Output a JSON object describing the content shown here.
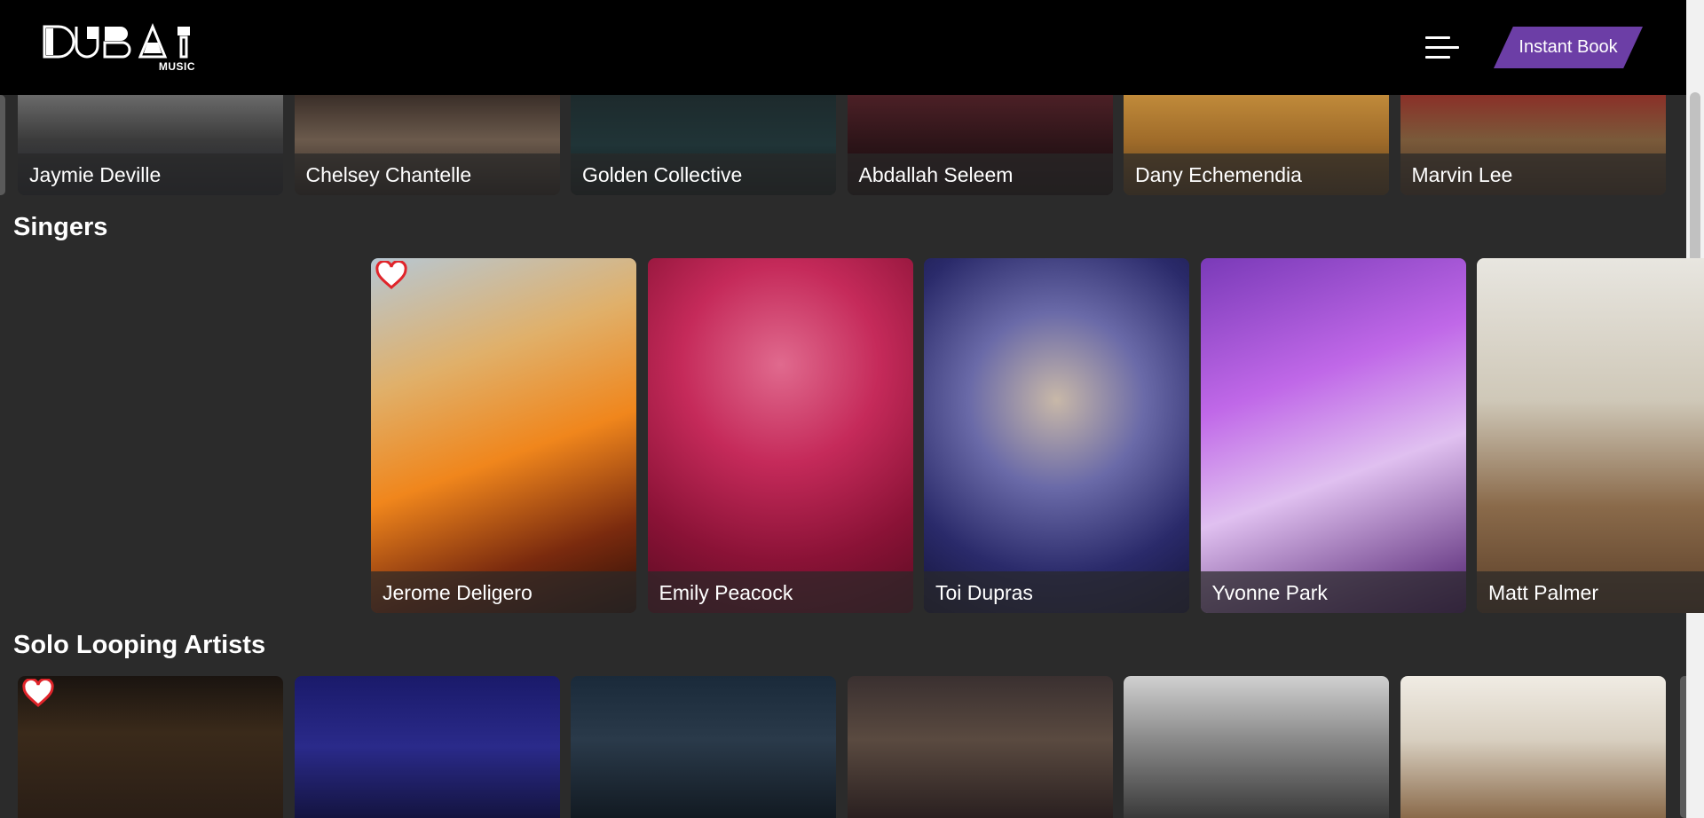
{
  "brand": {
    "name": "DUBAI",
    "sub": "MUSIC"
  },
  "header": {
    "instant_book_label": "Instant Book"
  },
  "top_row": {
    "artists": [
      {
        "name": "Jaymie Deville",
        "bg": "linear-gradient(180deg,#6a6a6a 0%,#3b3b3b 45%,#1d1f28 100%)"
      },
      {
        "name": "Chelsey Chantelle",
        "bg": "linear-gradient(180deg,#3a2e28 0%,#6b5a4c 45%,#2a221e 100%)"
      },
      {
        "name": "Golden Collective",
        "bg": "linear-gradient(180deg,#1d2a2c 0%,#203437 50%,#10181a 100%)"
      },
      {
        "name": "Abdallah Seleem",
        "bg": "linear-gradient(180deg,#4c2026 0%,#2c1418 50%,#140a0c 100%)"
      },
      {
        "name": "Dany Echemendia",
        "bg": "linear-gradient(180deg,#c08a3a 0%,#a06c2a 45%,#5a3e1e 100%)"
      },
      {
        "name": "Marvin Lee",
        "bg": "linear-gradient(180deg,#8a3028 0%,#7a5a3a 45%,#4a3424 100%)"
      }
    ]
  },
  "singers": {
    "title": "Singers",
    "artists": [
      {
        "name": "Jerome Deligero",
        "favorite": true,
        "bg": "linear-gradient(160deg,#b7c7d3 0%,#e0b06a 30%,#f0861c 55%,#7a2a0e 80%,#2a0f08 100%)"
      },
      {
        "name": "Emily Peacock",
        "favorite": false,
        "bg": "radial-gradient(circle at 50% 30%,#e06a8e 0%,#c52a5a 35%,#8a1236 70%,#5a0c22 100%)"
      },
      {
        "name": "Toi Dupras",
        "favorite": false,
        "bg": "radial-gradient(circle at 50% 40%,#c8b8a8 0%,#6a6aa8 35%,#2a2a6a 70%,#14143a 100%)"
      },
      {
        "name": "Yvonne Park",
        "favorite": false,
        "bg": "linear-gradient(160deg,#7a3ab8 0%,#c068e8 35%,#e0c0f0 60%,#4a1a6a 100%)"
      },
      {
        "name": "Matt Palmer",
        "favorite": false,
        "bg": "linear-gradient(180deg,#e8e6e0 0%,#cfc8b8 40%,#8a6a4a 70%,#5a3e28 100%)"
      }
    ]
  },
  "solo_looping": {
    "title": "Solo Looping Artists",
    "artists": [
      {
        "favorite": true,
        "bg": "linear-gradient(180deg,#1a1410 0%,#3a2a1a 40%,#2a1e16 100%)"
      },
      {
        "favorite": false,
        "bg": "linear-gradient(180deg,#1a1a6a 0%,#2a2a8a 50%,#141440 100%)"
      },
      {
        "favorite": false,
        "bg": "linear-gradient(180deg,#1a2a3a 0%,#2a3a4a 45%,#121a22 100%)"
      },
      {
        "favorite": false,
        "bg": "linear-gradient(180deg,#3a3030 0%,#5a4a40 45%,#2a2020 100%)"
      },
      {
        "favorite": false,
        "bg": "linear-gradient(180deg,#d0d0d0 0%,#8a8a8a 45%,#3a3a3a 100%)"
      },
      {
        "favorite": false,
        "bg": "linear-gradient(180deg,#f0ece4 0%,#d8cfc0 45%,#8a6a4a 100%)"
      }
    ]
  }
}
